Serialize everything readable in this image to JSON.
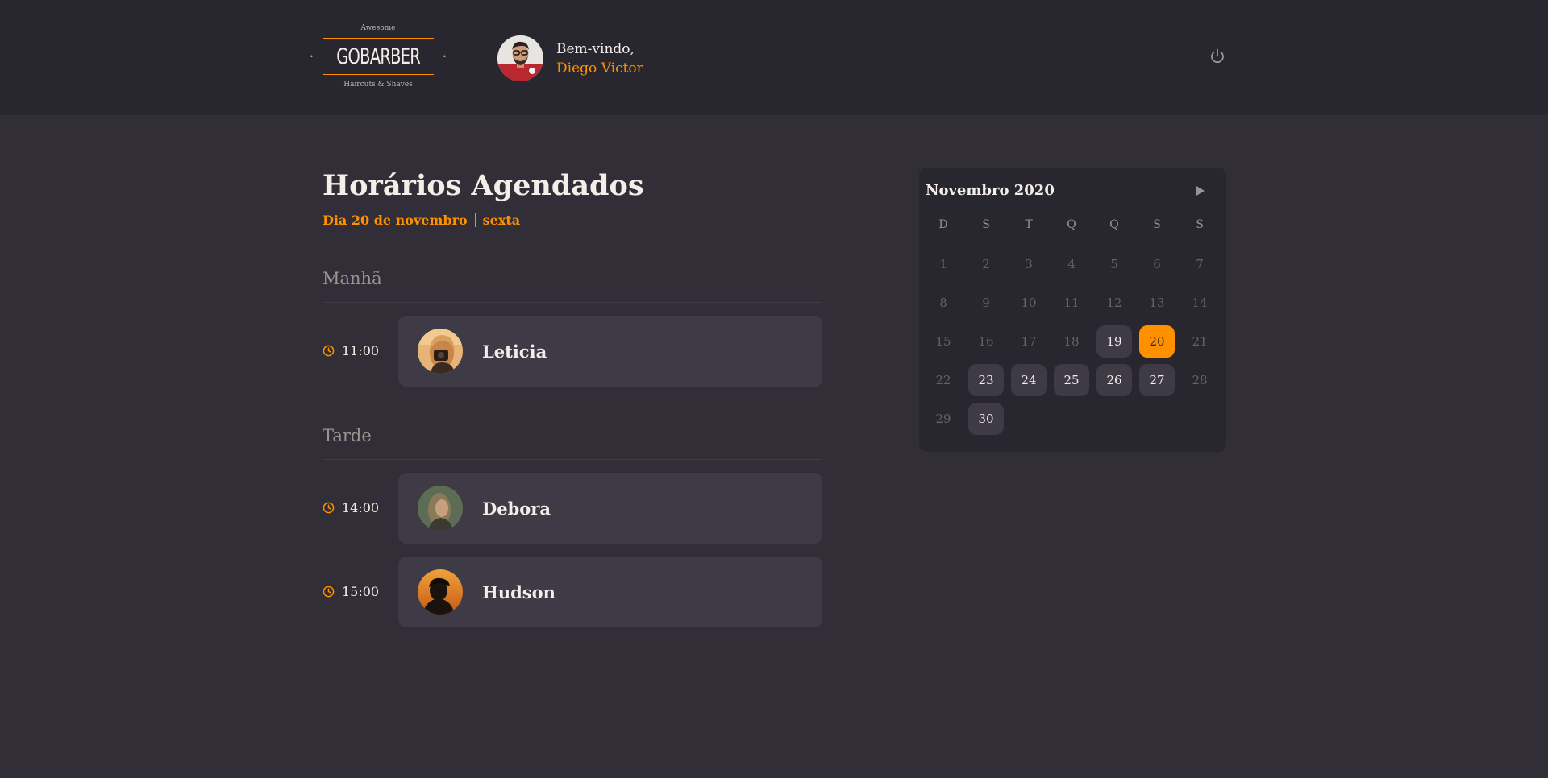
{
  "brand": {
    "top": "Awesome",
    "name": "GOBARBER",
    "tagline": "Haircuts & Shaves"
  },
  "user": {
    "greeting": "Bem-vindo,",
    "name": "Diego Victor"
  },
  "header": {
    "logout_icon": "power-icon"
  },
  "schedule": {
    "title": "Horários Agendados",
    "date_label": "Dia 20 de novembro",
    "weekday": "sexta",
    "morning": {
      "title": "Manhã",
      "appointments": [
        {
          "time": "11:00",
          "name": "Leticia"
        }
      ]
    },
    "afternoon": {
      "title": "Tarde",
      "appointments": [
        {
          "time": "14:00",
          "name": "Debora"
        },
        {
          "time": "15:00",
          "name": "Hudson"
        }
      ]
    }
  },
  "calendar": {
    "month_label": "Novembro 2020",
    "next_icon": "triangle-right-icon",
    "weekdays": [
      "D",
      "S",
      "T",
      "Q",
      "Q",
      "S",
      "S"
    ],
    "weeks": [
      [
        "1",
        "2",
        "3",
        "4",
        "5",
        "6",
        "7"
      ],
      [
        "8",
        "9",
        "10",
        "11",
        "12",
        "13",
        "14"
      ],
      [
        "15",
        "16",
        "17",
        "18",
        "19",
        "20",
        "21"
      ],
      [
        "22",
        "23",
        "24",
        "25",
        "26",
        "27",
        "28"
      ],
      [
        "29",
        "30"
      ]
    ],
    "available_days": [
      "19",
      "23",
      "24",
      "25",
      "26",
      "27",
      "30"
    ],
    "selected_day": "20"
  },
  "colors": {
    "accent": "#ff9000",
    "background": "#312e38",
    "header": "#28262e",
    "card": "#3e3b47"
  }
}
